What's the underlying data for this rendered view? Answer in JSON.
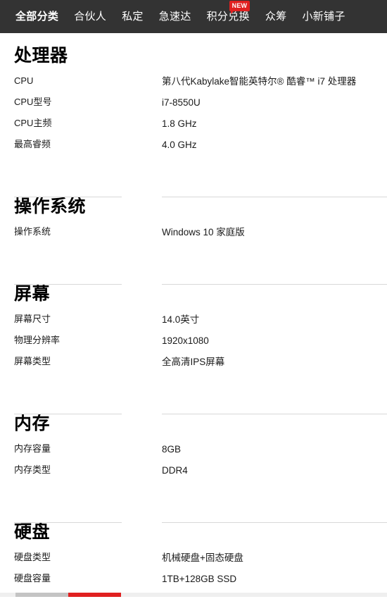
{
  "nav": {
    "items": [
      {
        "label": "全部分类",
        "active": true,
        "badge": null
      },
      {
        "label": "合伙人",
        "active": false,
        "badge": null
      },
      {
        "label": "私定",
        "active": false,
        "badge": null
      },
      {
        "label": "急速达",
        "active": false,
        "badge": null
      },
      {
        "label": "积分兑换",
        "active": false,
        "badge": "NEW"
      },
      {
        "label": "众筹",
        "active": false,
        "badge": null
      },
      {
        "label": "小新铺子",
        "active": false,
        "badge": null
      }
    ],
    "background_color": "#333333",
    "badge_color": "#e02020"
  },
  "spec_sheet": {
    "sections": [
      {
        "title": "处理器",
        "rows": [
          {
            "label": "CPU",
            "value": "第八代Kabylake智能英特尔® 酷睿™ i7 处理器"
          },
          {
            "label": "CPU型号",
            "value": "i7-8550U"
          },
          {
            "label": "CPU主频",
            "value": "1.8 GHz"
          },
          {
            "label": "最高睿频",
            "value": "4.0 GHz"
          }
        ]
      },
      {
        "title": "操作系统",
        "rows": [
          {
            "label": "操作系统",
            "value": "Windows 10 家庭版"
          }
        ]
      },
      {
        "title": "屏幕",
        "rows": [
          {
            "label": "屏幕尺寸",
            "value": "14.0英寸"
          },
          {
            "label": "物理分辨率",
            "value": "1920x1080"
          },
          {
            "label": "屏幕类型",
            "value": "全高清IPS屏幕"
          }
        ]
      },
      {
        "title": "内存",
        "rows": [
          {
            "label": "内存容量",
            "value": "8GB"
          },
          {
            "label": "内存类型",
            "value": "DDR4"
          }
        ]
      },
      {
        "title": "硬盘",
        "rows": [
          {
            "label": "硬盘类型",
            "value": "机械硬盘+固态硬盘"
          },
          {
            "label": "硬盘容量",
            "value": "1TB+128GB SSD"
          }
        ]
      }
    ]
  },
  "bottom_bar": {
    "track_color": "#efefef",
    "grey_segment_color": "#c4c4c4",
    "red_segment_color": "#e02020"
  }
}
